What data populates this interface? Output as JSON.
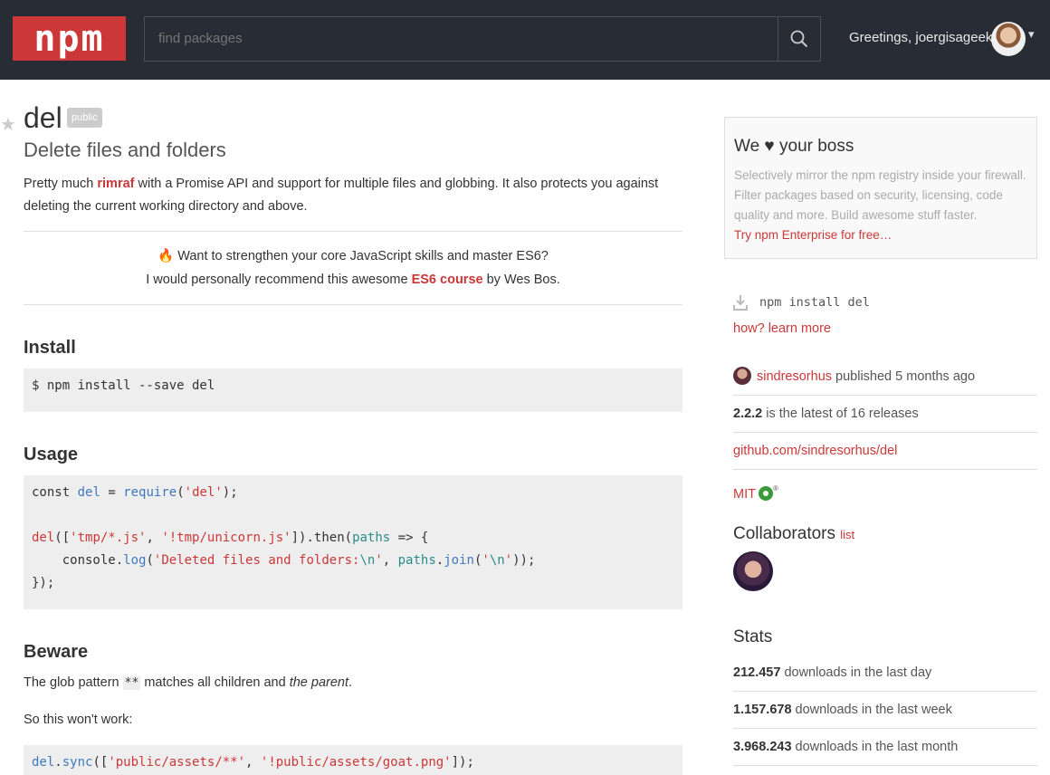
{
  "header": {
    "logo": "npm",
    "search_placeholder": "find packages",
    "greeting": "Greetings, joergisageek"
  },
  "package": {
    "name": "del",
    "badge": "public",
    "description": "Delete files and folders",
    "intro_before": "Pretty much ",
    "intro_link": "rimraf",
    "intro_after": " with a Promise API and support for multiple files and globbing. It also protects you against deleting the current working directory and above."
  },
  "promo": {
    "emoji": "🔥",
    "line1": " Want to strengthen your core JavaScript skills and master ES6?",
    "line2_before": "I would personally recommend this awesome ",
    "line2_link": "ES6 course",
    "line2_after": " by Wes Bos."
  },
  "readme": {
    "install_heading": "Install",
    "install_code": "$ npm install --save del",
    "usage_heading": "Usage",
    "beware_heading": "Beware",
    "beware_p1_before": "The glob pattern ",
    "beware_p1_code": "**",
    "beware_p1_middle": " matches all children and ",
    "beware_p1_em": "the parent",
    "beware_p1_after": ".",
    "beware_p2": "So this won't work:"
  },
  "sidebar": {
    "boss_title": "We ♥ your boss",
    "boss_body": "Selectively mirror the npm registry inside your firewall. Filter packages based on security, licensing, code quality and more. Build awesome stuff faster.",
    "boss_link": "Try npm Enterprise for free…",
    "install_cmd": "npm install del",
    "learn_link": "how? learn more",
    "publisher": "sindresorhus",
    "published_text": " published 5 months ago",
    "version": "2.2.2",
    "version_text": " is the latest of 16 releases",
    "repo": "github.com/sindresorhus/del",
    "license": "MIT",
    "collaborators_title": "Collaborators",
    "collaborators_link": "list",
    "stats_title": "Stats",
    "stats": [
      {
        "value": "212.457",
        "label": " downloads in the last day"
      },
      {
        "value": "1.157.678",
        "label": " downloads in the last week"
      },
      {
        "value": "3.968.243",
        "label": " downloads in the last month"
      }
    ]
  }
}
